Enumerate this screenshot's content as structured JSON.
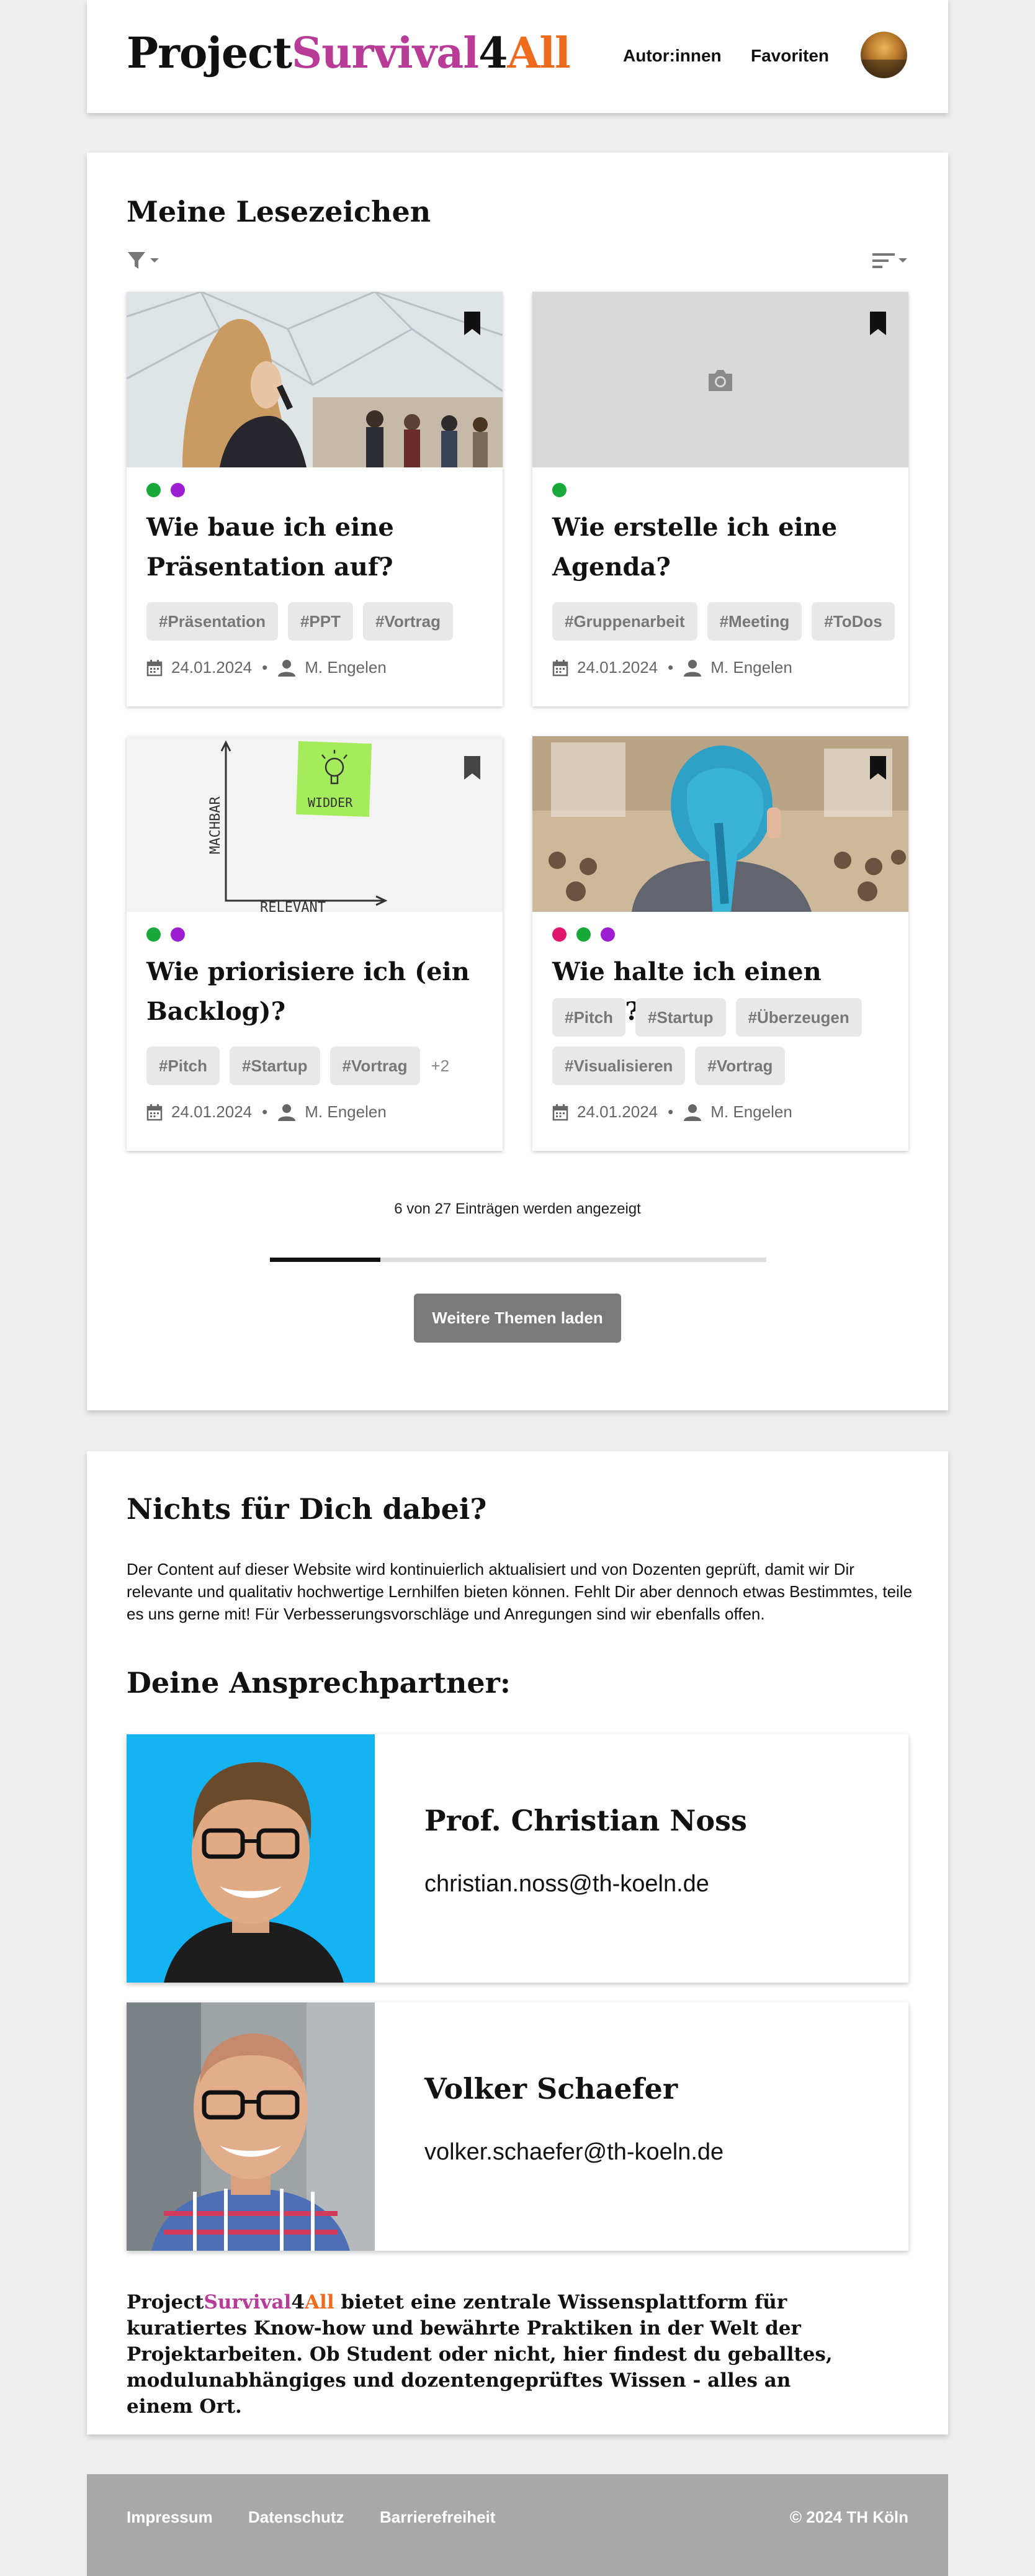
{
  "header": {
    "logo": {
      "part1": "Project",
      "part2": "Survival",
      "part3": "4",
      "part4": "All"
    },
    "nav": {
      "authors": "Autor:innen",
      "favorites": "Favoriten"
    }
  },
  "bookmarks": {
    "title": "Meine Lesezeichen",
    "filter_icon": "filter-icon",
    "sort_icon": "sort-icon",
    "cards": [
      {
        "title": "Wie baue ich eine Präsentation auf?",
        "dots": [
          "#19a83a",
          "#9b1fd1"
        ],
        "tags": [
          "#Präsentation",
          "#PPT",
          "#Vortrag"
        ],
        "more": "",
        "date": "24.01.2024",
        "author": "M. Engelen"
      },
      {
        "title": "Wie erstelle ich eine Agenda?",
        "dots": [
          "#19a83a"
        ],
        "tags": [
          "#Gruppenarbeit",
          "#Meeting",
          "#ToDos"
        ],
        "more": "",
        "date": "24.01.2024",
        "author": "M. Engelen"
      },
      {
        "title": "Wie priorisiere ich (ein Backlog)?",
        "dots": [
          "#19a83a",
          "#9b1fd1"
        ],
        "tags": [
          "#Pitch",
          "#Startup",
          "#Vortrag"
        ],
        "more": "+2",
        "date": "24.01.2024",
        "author": "M. Engelen",
        "sketch": {
          "y_label": "MACHBAR",
          "x_label": "RELEVANT",
          "note": "WIDDER"
        }
      },
      {
        "title": "Wie halte ich einen Pitch?",
        "dots": [
          "#e0156e",
          "#19a83a",
          "#9b1fd1"
        ],
        "tags": [
          "#Pitch",
          "#Startup",
          "#Überzeugen",
          "#Visualisieren",
          "#Vortrag"
        ],
        "more": "",
        "date": "24.01.2024",
        "author": "M. Engelen"
      }
    ],
    "count_text": "6 von 27 Einträgen werden angezeigt",
    "progress_fraction": 0.222,
    "load_more": "Weitere Themen laden"
  },
  "contact": {
    "title": "Nichts für Dich dabei?",
    "lead": "Der Content auf dieser Website wird kontinuierlich aktualisiert und von Dozenten geprüft, damit wir Dir relevante und qualitativ hochwertige Lernhilfen bieten können. Fehlt Dir aber dennoch etwas Bestimmtes, teile es uns gerne mit! Für Verbesserungsvorschläge und Anregungen sind wir ebenfalls offen.",
    "persons_title": "Deine Ansprechpartner:",
    "persons": [
      {
        "name": "Prof. Christian Noss",
        "email": "christian.noss@th-koeln.de"
      },
      {
        "name": "Volker Schaefer",
        "email": "volker.schaefer@th-koeln.de"
      }
    ],
    "outro": "bietet eine zentrale Wissensplattform für kuratiertes Know-how und bewährte Praktiken in der Welt der Projektarbeiten. Ob Student oder nicht, hier findest du geballtes, modulunabhängiges und dozentengeprüftes Wissen - alles an einem Ort."
  },
  "footer": {
    "links": [
      "Impressum",
      "Datenschutz",
      "Barrierefreiheit"
    ],
    "copyright": "© 2024 TH Köln"
  }
}
